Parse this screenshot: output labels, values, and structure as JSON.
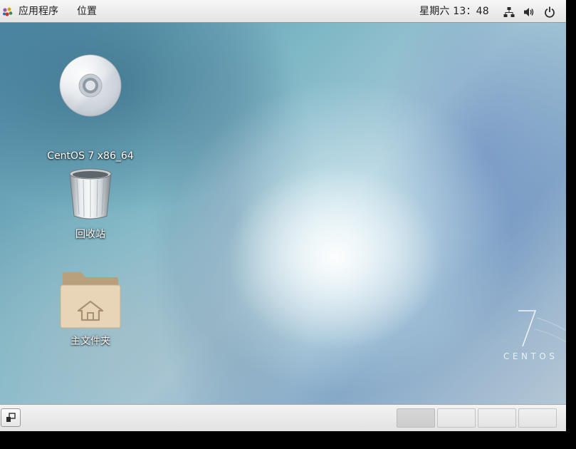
{
  "top_panel": {
    "applications_menu": "应用程序",
    "places_menu": "位置",
    "clock": "星期六 13：48",
    "tray": {
      "network": "network-icon",
      "volume": "volume-icon",
      "power": "power-icon"
    }
  },
  "desktop": {
    "items": [
      {
        "label": "CentOS 7 x86_64",
        "icon": "optical-disc-icon"
      },
      {
        "label": "回收站",
        "icon": "trash-icon"
      },
      {
        "label": "主文件夹",
        "icon": "home-folder-icon"
      }
    ],
    "logo": {
      "number": "7",
      "text": "CENTOS"
    }
  },
  "bottom_panel": {
    "show_desktop": "show-desktop-icon",
    "workspaces": [
      {
        "active": true
      },
      {
        "active": false
      },
      {
        "active": false
      },
      {
        "active": false
      }
    ]
  },
  "colors": {
    "panel": "#ececec",
    "folder": "#e7d3b5",
    "desktop_accent": "#7fb8c6"
  }
}
